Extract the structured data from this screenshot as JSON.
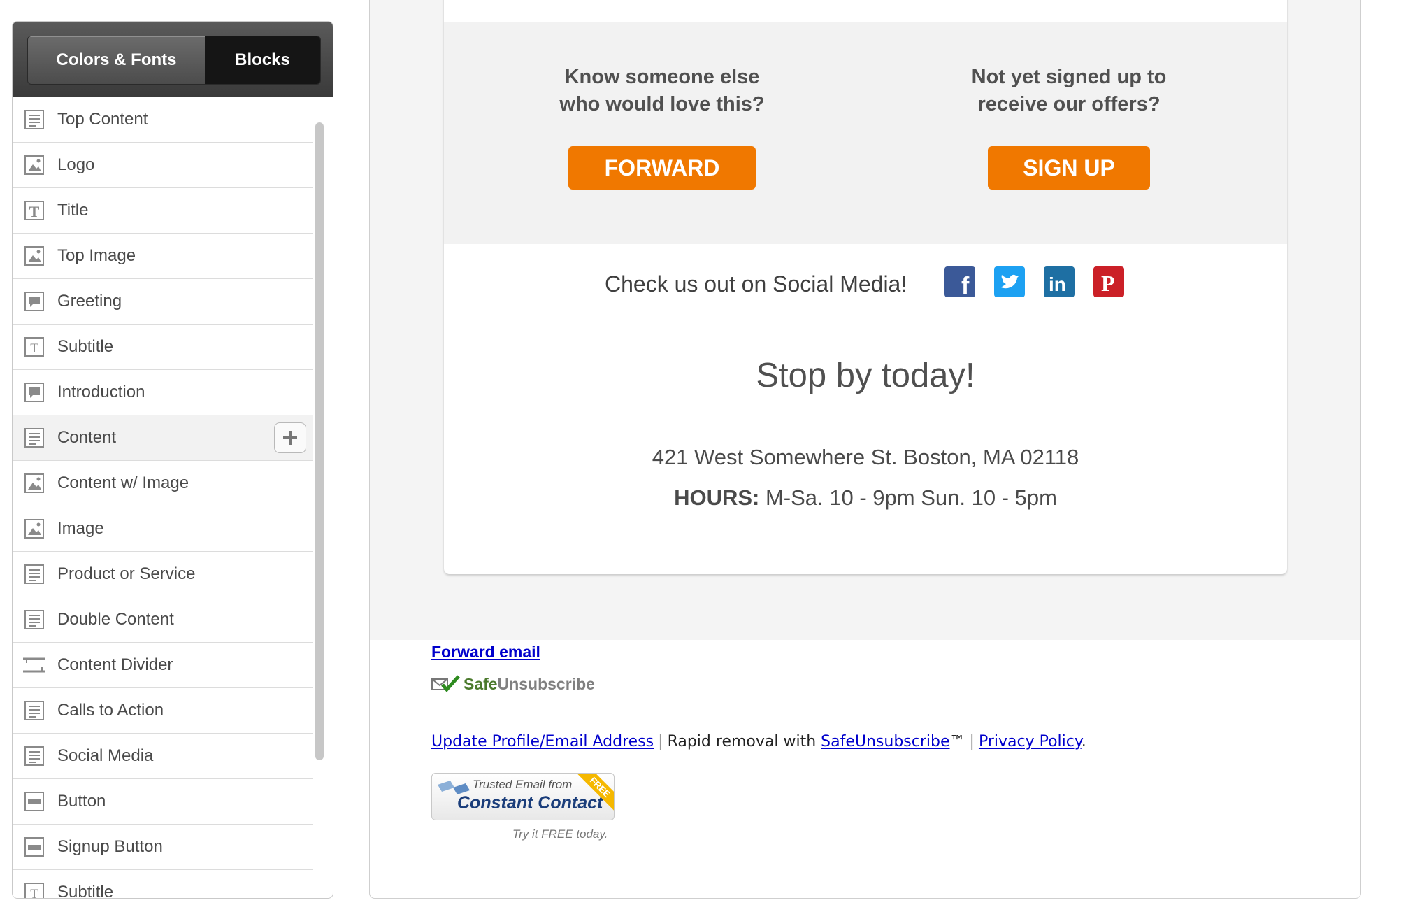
{
  "sidebar": {
    "tabs": [
      {
        "label": "Colors & Fonts",
        "active": false
      },
      {
        "label": "Blocks",
        "active": true
      }
    ],
    "blocks": [
      {
        "label": "Top Content",
        "icon": "text-block-icon"
      },
      {
        "label": "Logo",
        "icon": "image-icon"
      },
      {
        "label": "Title",
        "icon": "title-t-icon"
      },
      {
        "label": "Top Image",
        "icon": "image-icon"
      },
      {
        "label": "Greeting",
        "icon": "speech-bubble-icon"
      },
      {
        "label": "Subtitle",
        "icon": "subtitle-t-icon"
      },
      {
        "label": "Introduction",
        "icon": "speech-bubble-icon"
      },
      {
        "label": "Content",
        "icon": "text-block-icon",
        "active": true
      },
      {
        "label": "Content w/ Image",
        "icon": "image-icon"
      },
      {
        "label": "Image",
        "icon": "image-icon"
      },
      {
        "label": "Product or Service",
        "icon": "text-block-icon"
      },
      {
        "label": "Double Content",
        "icon": "text-block-icon"
      },
      {
        "label": "Content Divider",
        "icon": "divider-icon"
      },
      {
        "label": "Calls to Action",
        "icon": "text-block-icon"
      },
      {
        "label": "Social Media",
        "icon": "text-block-icon"
      },
      {
        "label": "Button",
        "icon": "button-icon"
      },
      {
        "label": "Signup Button",
        "icon": "button-icon"
      },
      {
        "label": "Subtitle",
        "icon": "subtitle-t-icon"
      }
    ],
    "add_icon": "plus-icon"
  },
  "email": {
    "forward_question": "Know someone else who would love this?",
    "forward_button": "FORWARD",
    "signup_question": "Not yet signed up to receive our offers?",
    "signup_button": "SIGN UP",
    "social_text": "Check us out on Social Media!",
    "social_icons": [
      "facebook-icon",
      "twitter-icon",
      "linkedin-icon",
      "pinterest-icon"
    ],
    "stop_heading": "Stop by today!",
    "address": "421 West Somewhere St. Boston, MA 02118",
    "hours_label": "HOURS:",
    "hours_value": " M-Sa. 10 - 9pm Sun. 10 - 5pm",
    "accent_color": "#f07800"
  },
  "footer": {
    "forward_email": "Forward email",
    "safe_unsub_safe": "Safe",
    "safe_unsub_rest": "Unsubscribe",
    "update_profile": "Update Profile/Email Address",
    "rapid_removal": "Rapid removal with",
    "safeunsubscribe_link": "SafeUnsubscribe",
    "tm": "™",
    "privacy_policy": "Privacy Policy",
    "period": ".",
    "cc_trusted": "Trusted Email from",
    "cc_name": "Constant Contact",
    "cc_free": "FREE",
    "cc_try": "Try it FREE today."
  }
}
